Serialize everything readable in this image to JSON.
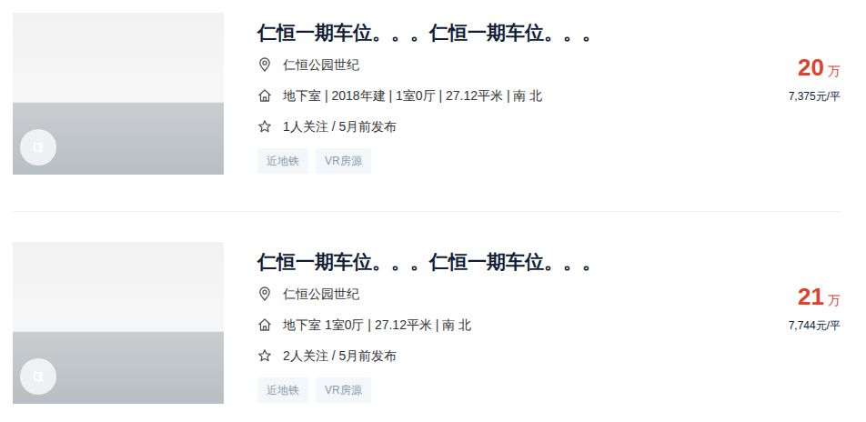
{
  "listings": [
    {
      "title": "仁恒一期车位。。。仁恒一期车位。。。",
      "community": "仁恒公园世纪",
      "info": "地下室 | 2018年建 | 1室0厅 | 27.12平米 | 南 北",
      "follow": "1人关注 / 5月前发布",
      "tags": [
        "近地铁",
        "VR房源"
      ],
      "price": "20",
      "price_unit": "万",
      "unit_price": "7,375元/平"
    },
    {
      "title": "仁恒一期车位。。。仁恒一期车位。。。",
      "community": "仁恒公园世纪",
      "info": "地下室 1室0厅 | 27.12平米 | 南 北",
      "follow": "2人关注 / 5月前发布",
      "tags": [
        "近地铁",
        "VR房源"
      ],
      "price": "21",
      "price_unit": "万",
      "unit_price": "7,744元/平"
    }
  ]
}
